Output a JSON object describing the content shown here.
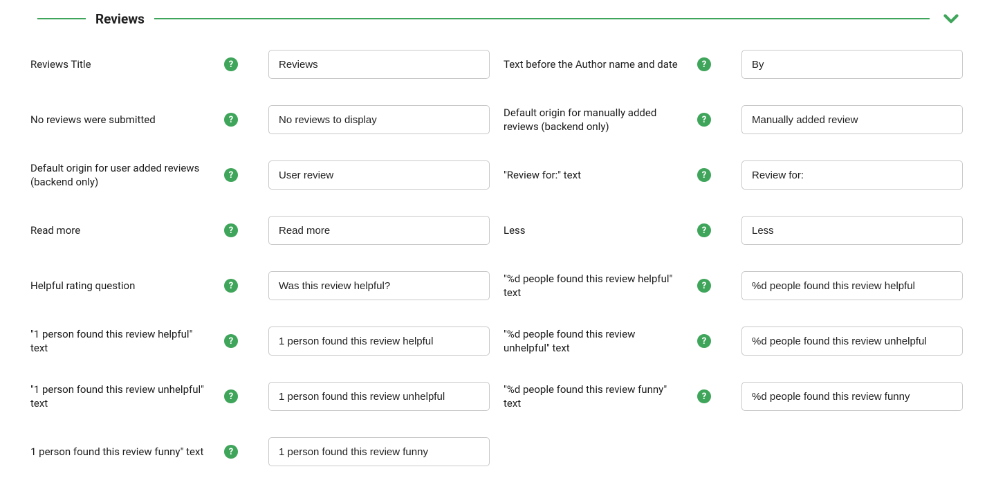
{
  "section": {
    "title": "Reviews"
  },
  "fields": {
    "reviews_title": {
      "label": "Reviews Title",
      "value": "Reviews"
    },
    "author_prefix": {
      "label": "Text before the Author name and date",
      "value": "By"
    },
    "no_reviews": {
      "label": "No reviews were submitted",
      "value": "No reviews to display"
    },
    "origin_manual": {
      "label": "Default origin for manually added reviews (backend only)",
      "value": "Manually added review"
    },
    "origin_user": {
      "label": "Default origin for user added reviews (backend only)",
      "value": "User review"
    },
    "review_for": {
      "label": "\"Review for:\" text",
      "value": "Review for:"
    },
    "read_more": {
      "label": "Read more",
      "value": "Read more"
    },
    "less": {
      "label": "Less",
      "value": "Less"
    },
    "helpful_question": {
      "label": "Helpful rating question",
      "value": "Was this review helpful?"
    },
    "d_helpful": {
      "label": "\"%d people found this review helpful\" text",
      "value": "%d people found this review helpful"
    },
    "one_helpful": {
      "label": "\"1 person found this review helpful\" text",
      "value": "1 person found this review helpful"
    },
    "d_unhelpful": {
      "label": "\"%d people found this review unhelpful\" text",
      "value": "%d people found this review unhelpful"
    },
    "one_unhelpful": {
      "label": "\"1 person found this review unhelpful\" text",
      "value": "1 person found this review unhelpful"
    },
    "d_funny": {
      "label": "\"%d people found this review funny\" text",
      "value": "%d people found this review funny"
    },
    "one_funny": {
      "label": "1 person found this review funny\" text",
      "value": "1 person found this review funny"
    }
  }
}
